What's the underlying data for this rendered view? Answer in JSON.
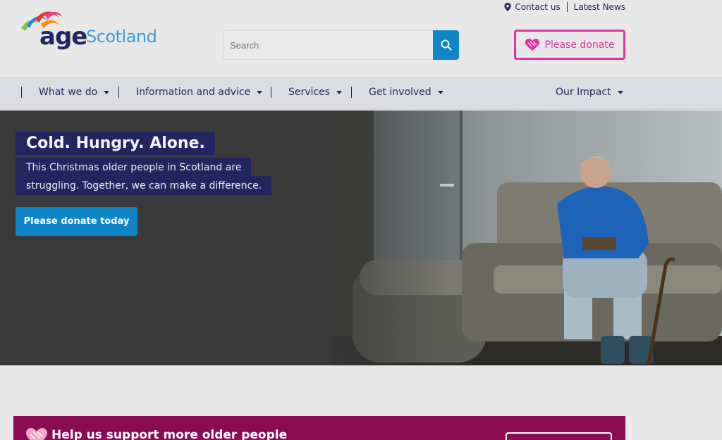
{
  "utility": {
    "contact": "Contact us",
    "news": "Latest News"
  },
  "logo": {
    "age": "age",
    "scotland": "Scotland"
  },
  "search": {
    "placeholder": "Search"
  },
  "header": {
    "donate_label": "Please donate"
  },
  "nav": {
    "items": [
      {
        "label": "What we do"
      },
      {
        "label": "Information and advice"
      },
      {
        "label": "Services"
      },
      {
        "label": "Get involved"
      },
      {
        "label": "Our Impact"
      }
    ]
  },
  "hero": {
    "title": "Cold. Hungry. Alone.",
    "subtitle": "This Christmas older people in Scotland are struggling. Together, we can make a difference.",
    "cta": "Please donate today"
  },
  "banner": {
    "title": "Help us support more older people"
  },
  "colors": {
    "navy": "#23265e",
    "blue": "#0f86c8",
    "pink": "#e0339c",
    "banner": "#8c0c54"
  }
}
